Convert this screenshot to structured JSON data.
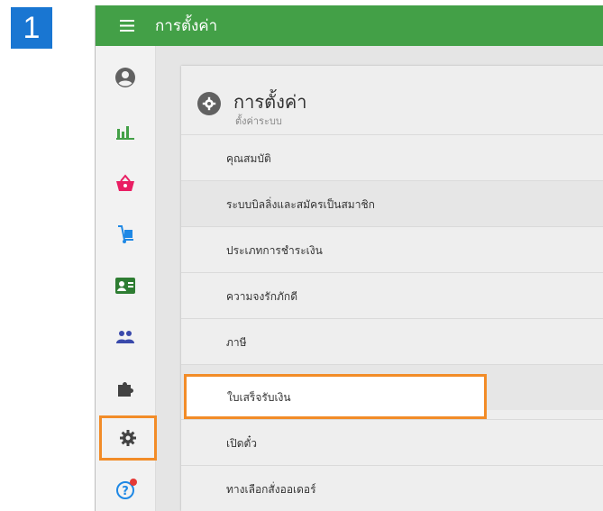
{
  "step_number": "1",
  "appbar": {
    "title": "การตั้งค่า"
  },
  "sidebar": {
    "items": [
      {
        "icon": "account-circle-icon"
      },
      {
        "icon": "bar-chart-icon"
      },
      {
        "icon": "shopping-basket-icon"
      },
      {
        "icon": "hand-truck-icon"
      },
      {
        "icon": "id-card-icon"
      },
      {
        "icon": "people-icon"
      },
      {
        "icon": "puzzle-piece-icon"
      },
      {
        "icon": "gear-icon",
        "active": true
      },
      {
        "icon": "help-icon"
      }
    ]
  },
  "settings": {
    "title": "การตั้งค่า",
    "subtitle": "ตั้งค่าระบบ",
    "items": [
      {
        "label": "คุณสมบัติ"
      },
      {
        "label": "ระบบบิลลิ่งและสมัครเป็นสมาชิก"
      },
      {
        "label": "ประเภทการชำระเงิน"
      },
      {
        "label": "ความจงรักภักดี"
      },
      {
        "label": "ภาษี"
      },
      {
        "label": "ใบเสร็จรับเงิน",
        "highlighted": true
      },
      {
        "label": "เปิดตั๋ว"
      },
      {
        "label": "ทางเลือกสั่งออเดอร์"
      }
    ]
  },
  "colors": {
    "appbar": "#43a047",
    "highlight": "#f28c28",
    "step_badge": "#1976d2"
  }
}
